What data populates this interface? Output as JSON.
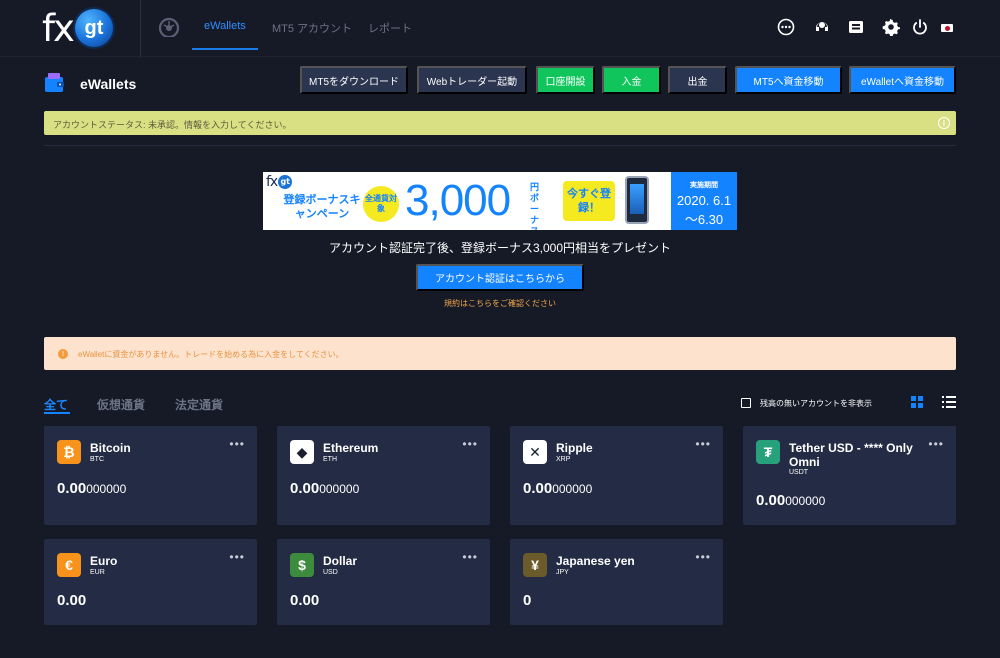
{
  "nav": {
    "logo_fx": "fx",
    "logo_gt": "gt",
    "tabs": [
      {
        "label": "eWallets",
        "active": true
      },
      {
        "label": "MT5 アカウント",
        "active": false
      },
      {
        "label": "レポート",
        "active": false
      }
    ],
    "icons": [
      "chat-icon",
      "support-icon",
      "inbox-icon",
      "settings-icon",
      "power-icon",
      "japan-flag-icon"
    ]
  },
  "header": {
    "title": "eWallets",
    "buttons": [
      {
        "label": "MT5をダウンロード",
        "style": "dark"
      },
      {
        "label": "Webトレーダー起動",
        "style": "dark"
      },
      {
        "label": "口座開設",
        "style": "green"
      },
      {
        "label": "入金",
        "style": "green"
      },
      {
        "label": "出金",
        "style": "dark"
      },
      {
        "label": "MT5へ資金移動",
        "style": "blue"
      },
      {
        "label": "eWalletへ資金移動",
        "style": "blue"
      }
    ]
  },
  "status": {
    "text": "アカウントステータス: 未承認。情報を入力してください。",
    "info_icon": "i"
  },
  "banner": {
    "logo_fx": "fx",
    "logo_gt": "gt",
    "campaign": "登録ボーナスキャンペーン",
    "badge": "全通貨対象",
    "amount": "3,000",
    "unit": "円ボーナス",
    "cta": "今すぐ登録！",
    "period_label": "実施期間",
    "period_start": "2020. 6.1",
    "period_end": "〜6.30"
  },
  "promo": {
    "text": "アカウント認証完了後、登録ボーナス3,000円相当をプレゼント",
    "button": "アカウント認証はこちらから",
    "terms": "規約はこちらをご確認ください"
  },
  "warning": {
    "icon": "!",
    "text": "eWalletに資金がありません。トレードを始める為に入金をしてください。"
  },
  "filters": {
    "tabs": [
      "全て",
      "仮想通貨",
      "法定通貨"
    ],
    "active": "全て",
    "hide_label": "残高の無いアカウントを非表示",
    "hide_checked": false
  },
  "wallets": [
    {
      "name": "Bitcoin",
      "code": "BTC",
      "balance_main": "0.00",
      "balance_sub": "000000",
      "icon": "bitcoin-icon",
      "glyph": "₿",
      "color": "#f7931a"
    },
    {
      "name": "Ethereum",
      "code": "ETH",
      "balance_main": "0.00",
      "balance_sub": "000000",
      "icon": "ethereum-icon",
      "glyph": "◆",
      "color": "#ffffff"
    },
    {
      "name": "Ripple",
      "code": "XRP",
      "balance_main": "0.00",
      "balance_sub": "000000",
      "icon": "ripple-icon",
      "glyph": "✕",
      "color": "#ffffff"
    },
    {
      "name": "Tether USD - **** Only Omni",
      "code": "USDT",
      "balance_main": "0.00",
      "balance_sub": "000000",
      "icon": "tether-icon",
      "glyph": "₮",
      "color": "#26a17b"
    },
    {
      "name": "Euro",
      "code": "EUR",
      "balance_main": "0.00",
      "balance_sub": "",
      "icon": "euro-icon",
      "glyph": "€",
      "color": "#f7931a"
    },
    {
      "name": "Dollar",
      "code": "USD",
      "balance_main": "0.00",
      "balance_sub": "",
      "icon": "dollar-icon",
      "glyph": "$",
      "color": "#3d8b3d"
    },
    {
      "name": "Japanese yen",
      "code": "JPY",
      "balance_main": "0",
      "balance_sub": "",
      "icon": "yen-icon",
      "glyph": "¥",
      "color": "#6b5a2a"
    }
  ]
}
